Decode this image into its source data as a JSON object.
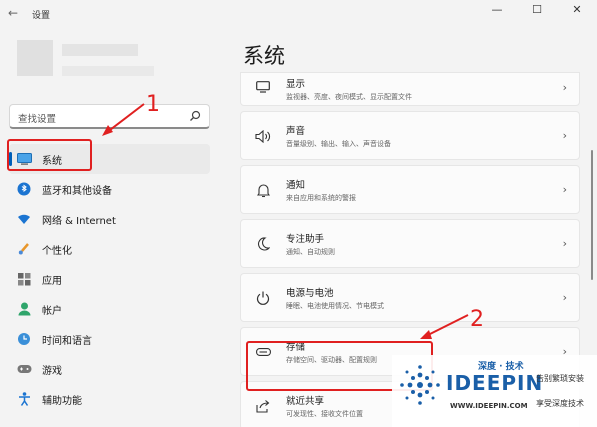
{
  "window": {
    "back_glyph": "←",
    "title": "设置",
    "minimize_glyph": "—",
    "maximize_glyph": "☐",
    "close_glyph": "✕"
  },
  "search": {
    "placeholder": "查找设置",
    "icon": "search-icon"
  },
  "sidebar": {
    "items": [
      {
        "label": "系统",
        "icon": "monitor-icon",
        "active": true
      },
      {
        "label": "蓝牙和其他设备",
        "icon": "bluetooth-icon"
      },
      {
        "label": "网络 & Internet",
        "icon": "wifi-icon"
      },
      {
        "label": "个性化",
        "icon": "brush-icon"
      },
      {
        "label": "应用",
        "icon": "apps-icon"
      },
      {
        "label": "帐户",
        "icon": "person-icon"
      },
      {
        "label": "时间和语言",
        "icon": "globe-clock-icon"
      },
      {
        "label": "游戏",
        "icon": "gamepad-icon"
      },
      {
        "label": "辅助功能",
        "icon": "accessibility-icon"
      }
    ]
  },
  "main": {
    "title": "系统",
    "cards": [
      {
        "title": "显示",
        "subtitle": "监视器、亮度、夜间模式、显示配置文件",
        "icon": "display-icon"
      },
      {
        "title": "声音",
        "subtitle": "音量级别、输出、输入、声音设备",
        "icon": "speaker-icon"
      },
      {
        "title": "通知",
        "subtitle": "来自应用和系统的警报",
        "icon": "bell-icon"
      },
      {
        "title": "专注助手",
        "subtitle": "通知、自动规则",
        "icon": "moon-icon"
      },
      {
        "title": "电源与电池",
        "subtitle": "睡眠、电池使用情况、节电模式",
        "icon": "power-icon"
      },
      {
        "title": "存储",
        "subtitle": "存储空间、驱动器、配置规则",
        "icon": "storage-icon"
      },
      {
        "title": "就近共享",
        "subtitle": "可发现性、接收文件位置",
        "icon": "share-icon"
      }
    ],
    "chevron": "›"
  },
  "annotations": {
    "label_1": "1",
    "label_2": "2",
    "color": "#e02020"
  },
  "watermark": {
    "brand_cn": "深度 · 技术",
    "brand": "IDEEPIN",
    "url": "WWW.IDEEPIN.COM",
    "tagline_1": "告别繁琐安装",
    "tagline_2": "享受深度技术"
  },
  "colors": {
    "accent": "#005fb8",
    "background": "#f3f3f3",
    "card": "#fbfbfb"
  }
}
